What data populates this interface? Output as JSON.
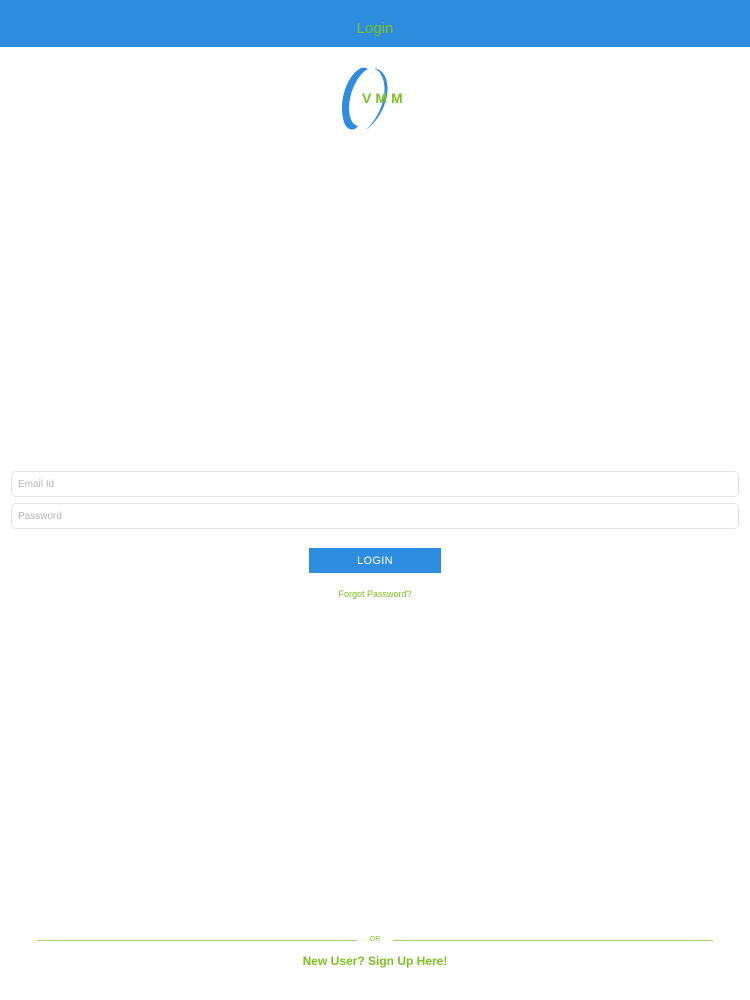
{
  "navbar": {
    "title": "Login"
  },
  "logo": {
    "text": "VMM",
    "brand_blue": "#2e8ddf",
    "brand_green": "#7cc221"
  },
  "form": {
    "email_placeholder": "Email Id",
    "email_value": "",
    "password_placeholder": "Password",
    "password_value": "",
    "login_label": "LOGIN",
    "forgot_label": "Forgot Password?"
  },
  "footer": {
    "or_label": "OR",
    "signup_label": "New User? Sign Up Here!"
  },
  "colors": {
    "primary": "#2e8ddf",
    "accent": "#7cc221",
    "background": "#ffffff"
  }
}
